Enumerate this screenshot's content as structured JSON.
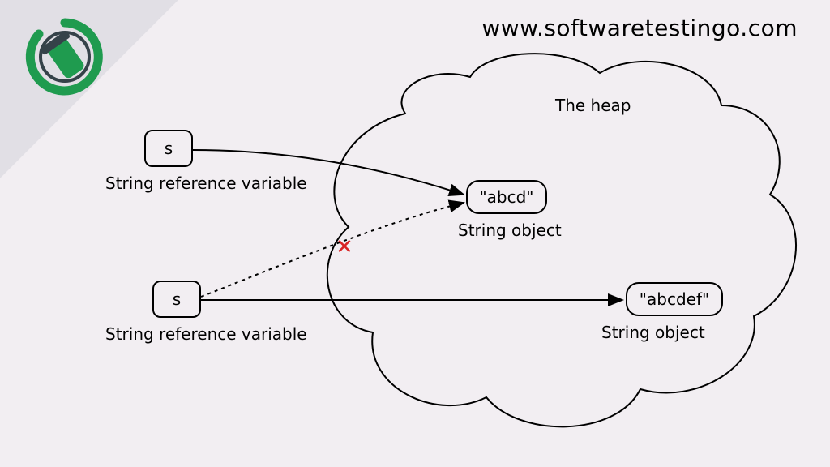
{
  "site": {
    "url": "www.softwaretestingo.com"
  },
  "diagram": {
    "heap_label": "The heap",
    "ref1": {
      "var": "s",
      "label": "String reference variable"
    },
    "ref2": {
      "var": "s",
      "label": "String reference variable"
    },
    "obj1": {
      "value": "\"abcd\"",
      "label": "String object"
    },
    "obj2": {
      "value": "\"abcdef\"",
      "label": "String object"
    },
    "cross_mark": "✕"
  }
}
